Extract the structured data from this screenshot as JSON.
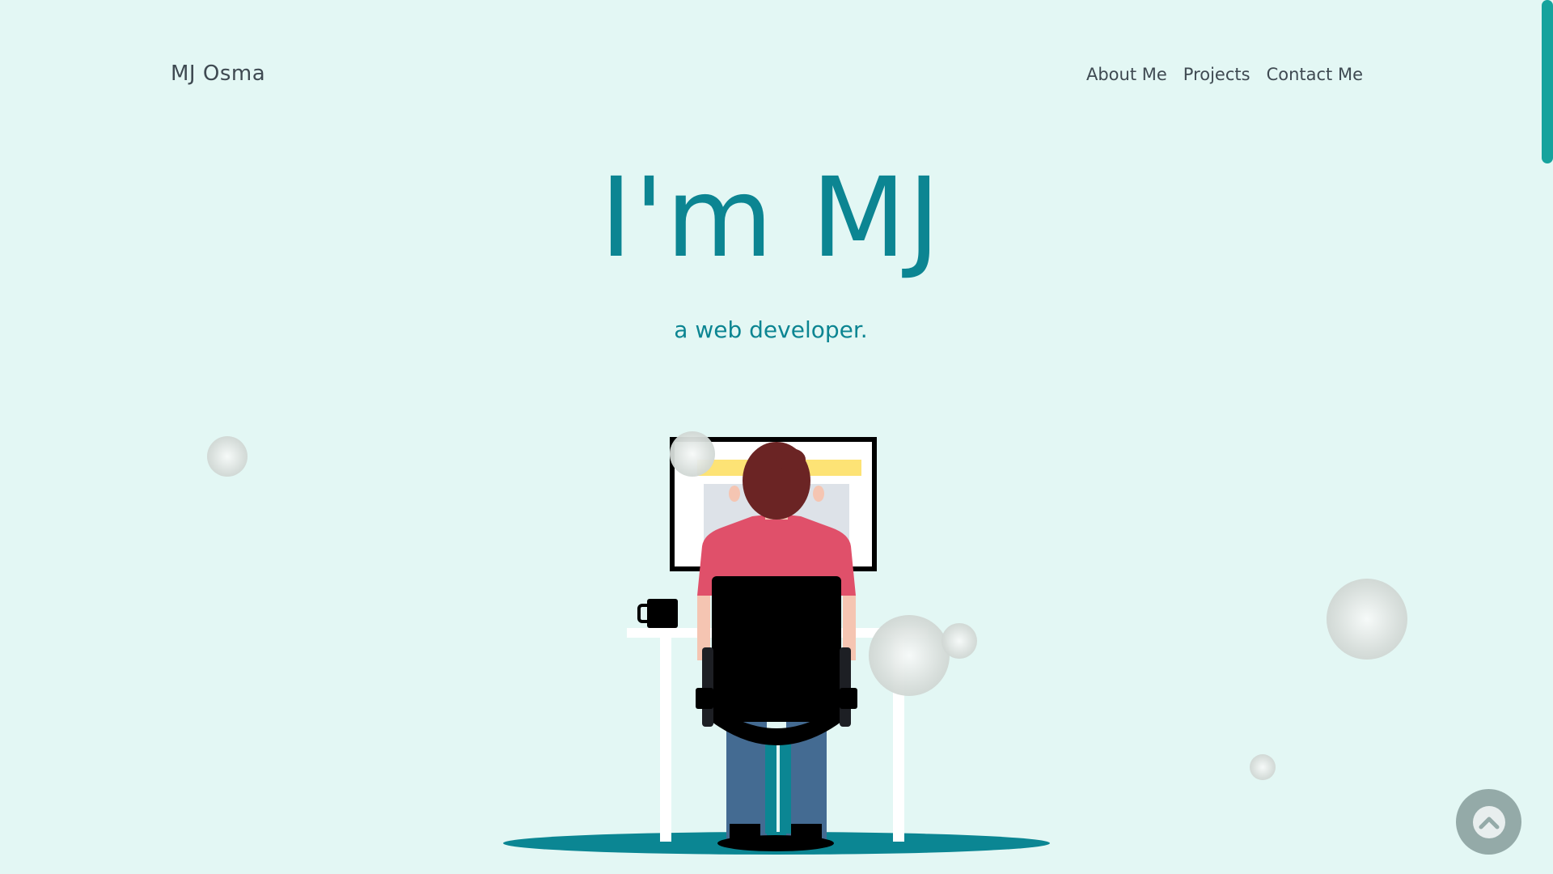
{
  "header": {
    "brand": "MJ Osma",
    "nav": [
      {
        "label": "About Me"
      },
      {
        "label": "Projects"
      },
      {
        "label": "Contact Me"
      }
    ]
  },
  "hero": {
    "title": "I'm MJ",
    "subtitle": "a web developer."
  },
  "icons": {
    "scroll_top": "chevron-up-icon"
  },
  "colors": {
    "background": "#e3f7f4",
    "accent": "#0c8592",
    "scrollbar": "#16a39d",
    "nav_text": "#3f4a52"
  }
}
